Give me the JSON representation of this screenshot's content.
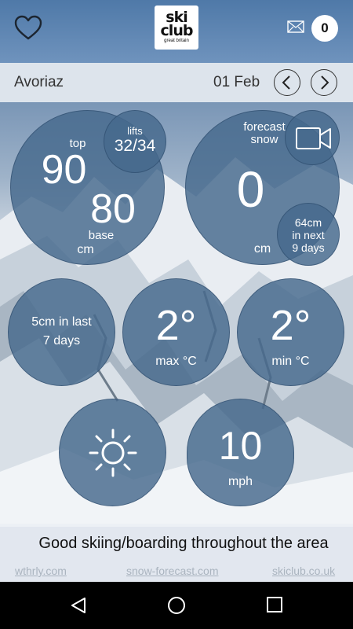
{
  "header": {
    "logo_line1": "ski",
    "logo_line2": "club",
    "logo_line3": "great britain",
    "message_count": "0"
  },
  "location": {
    "name": "Avoriaz",
    "date": "01 Feb"
  },
  "snow_depth": {
    "top_label": "top",
    "top_value": "90",
    "base_value": "80",
    "base_label": "base",
    "unit": "cm"
  },
  "lifts": {
    "label": "lifts",
    "value": "32/34"
  },
  "forecast": {
    "label_line1": "forecast",
    "label_line2": "snow",
    "value": "0",
    "unit": "cm",
    "next_line1": "64cm",
    "next_line2": "in next",
    "next_line3": "9 days"
  },
  "recent_snow": {
    "line1": "5cm in last",
    "line2": "7 days"
  },
  "max_temp": {
    "value": "2°",
    "label": "max °C"
  },
  "min_temp": {
    "value": "2°",
    "label": "min °C"
  },
  "weather": {
    "icon": "sun-icon"
  },
  "wind": {
    "value": "10",
    "unit": "mph"
  },
  "footer": {
    "message": "Good skiing/boarding throughout the area",
    "links": [
      "wthrly.com",
      "snow-forecast.com",
      "skiclub.co.uk"
    ]
  },
  "colors": {
    "topbar": "#4f79a8",
    "bubble": "#46698c",
    "locbar": "#dde4ec"
  }
}
